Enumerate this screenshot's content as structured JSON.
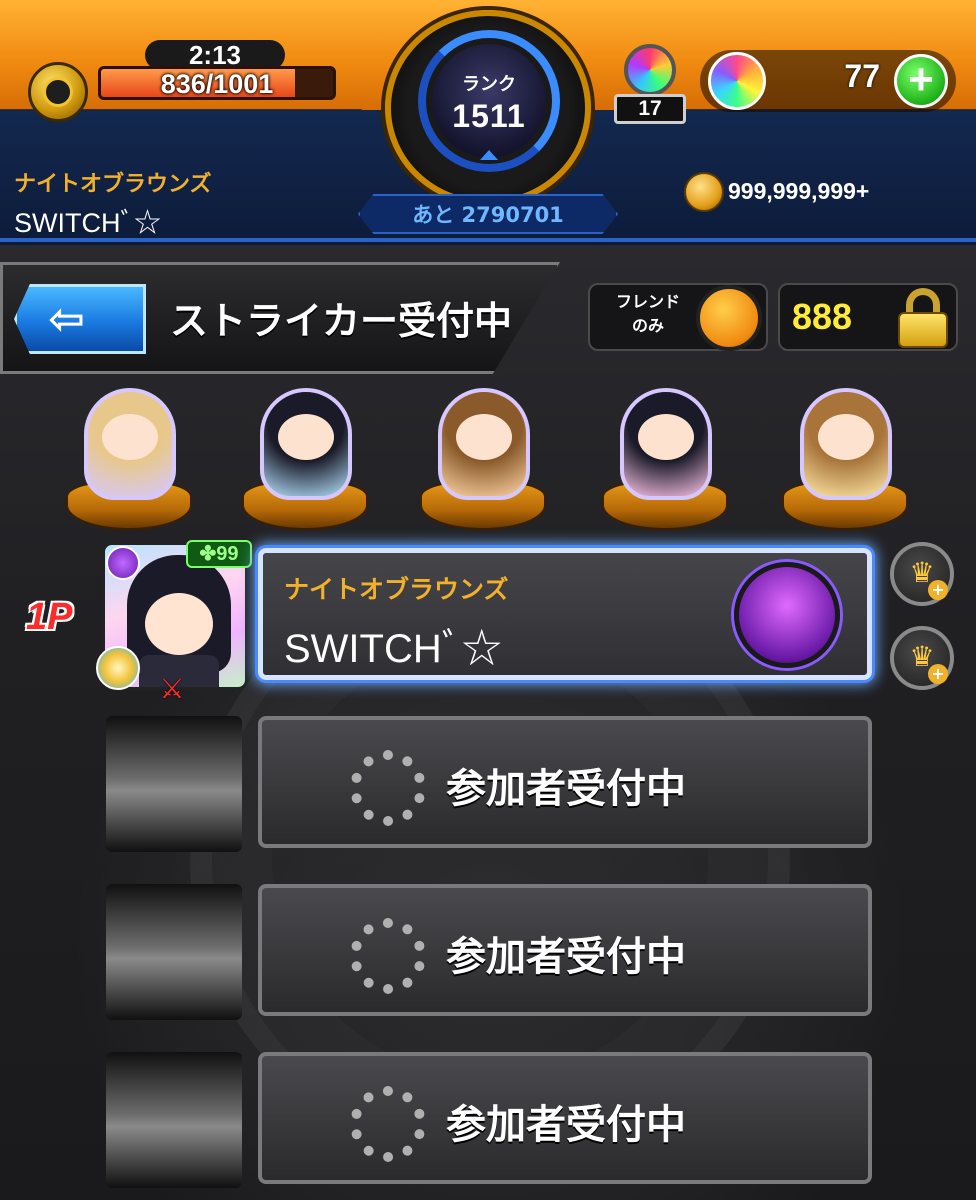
{
  "header": {
    "stamina_timer": "2:13",
    "stamina": "836/1001",
    "stamina_fraction": 0.835,
    "rank_label": "ランク",
    "rank_value": "1511",
    "rank_next": "あと 2790701",
    "gacha_count": "17",
    "orb_count": "77",
    "orb_add_label": "+",
    "team_name": "ナイトオブラウンズ",
    "player_name": "SWITCHﾞ☆",
    "coins": "999,999,999+"
  },
  "title_bar": {
    "back_label": "⇦",
    "title": "ストライカー受付中",
    "friend_filter_label": "フレンド\nのみ",
    "password": "888"
  },
  "deck": {
    "slots": [
      {
        "icon": "character-figure-icon",
        "hair": "#e8c88a",
        "aura": "#d6c7ff"
      },
      {
        "icon": "character-figure-icon",
        "hair": "#1a1a28",
        "aura": "#b6e4ff"
      },
      {
        "icon": "character-figure-icon",
        "hair": "#8a5a2a",
        "aura": "#ffd6a8"
      },
      {
        "icon": "character-figure-icon",
        "hair": "#1a1a28",
        "aura": "#ffc6ea"
      },
      {
        "icon": "character-figure-icon",
        "hair": "#a8743a",
        "aura": "#ffe9a8"
      }
    ]
  },
  "players": {
    "p1_label": "1P",
    "p1_luck": "✤99",
    "p1_type": "⚔",
    "p1_team": "ナイトオブラウンズ",
    "p1_name": "SWITCHﾞ☆",
    "crown_glyph": "♛",
    "crown_plus": "+",
    "waiting_label": "参加者受付中"
  },
  "colors": {
    "accent_orange": "#f08a10",
    "team_gold": "#f2b12a",
    "active_border": "#4a8aff",
    "p1_red": "#ff2a2a"
  }
}
